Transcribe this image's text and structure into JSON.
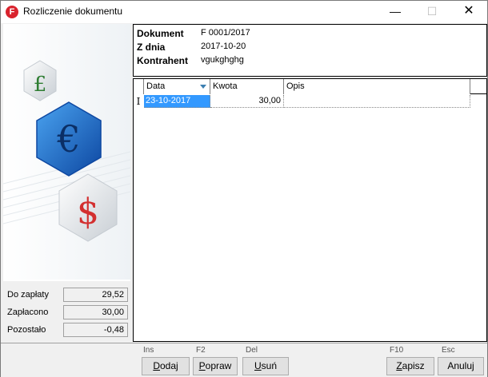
{
  "window": {
    "title": "Rozliczenie dokumentu",
    "app_icon_letter": "F",
    "minimize_glyph": "—",
    "maximize_glyph": "☐",
    "close_glyph": "✕"
  },
  "summary": {
    "rows": [
      {
        "label": "Do zapłaty",
        "value": "29,52"
      },
      {
        "label": "Zapłacono",
        "value": "30,00"
      },
      {
        "label": "Pozostało",
        "value": "-0,48"
      }
    ]
  },
  "document": {
    "rows": [
      {
        "label": "Dokument",
        "value": "F 0001/2017"
      },
      {
        "label": "Z dnia",
        "value": "2017-10-20"
      },
      {
        "label": "Kontrahent",
        "value": "vgukghghg"
      }
    ]
  },
  "grid": {
    "columns": [
      "Data",
      "Kwota",
      "Opis"
    ],
    "rows": [
      {
        "indicator": "I",
        "date": "23-10-2017",
        "amount": "30,00",
        "description": ""
      }
    ]
  },
  "buttons": [
    {
      "hotkey": "Ins",
      "label_underlined": "D",
      "label_rest": "odaj"
    },
    {
      "hotkey": "F2",
      "label_underlined": "P",
      "label_rest": "opraw"
    },
    {
      "hotkey": "Del",
      "label_underlined": "U",
      "label_rest": "suń"
    },
    {
      "hotkey": "F10",
      "label_underlined": "Z",
      "label_rest": "apisz"
    },
    {
      "hotkey": "Esc",
      "label_underlined": "",
      "label_rest": "Anuluj"
    }
  ],
  "icons": {
    "pound": "pound-coin-icon",
    "euro": "euro-coin-icon",
    "dollar": "dollar-coin-icon"
  },
  "colors": {
    "selection": "#3399ff",
    "euro_blue": "#1565c0",
    "dollar_red": "#d32f2f",
    "pound_green": "#2e7d32"
  }
}
